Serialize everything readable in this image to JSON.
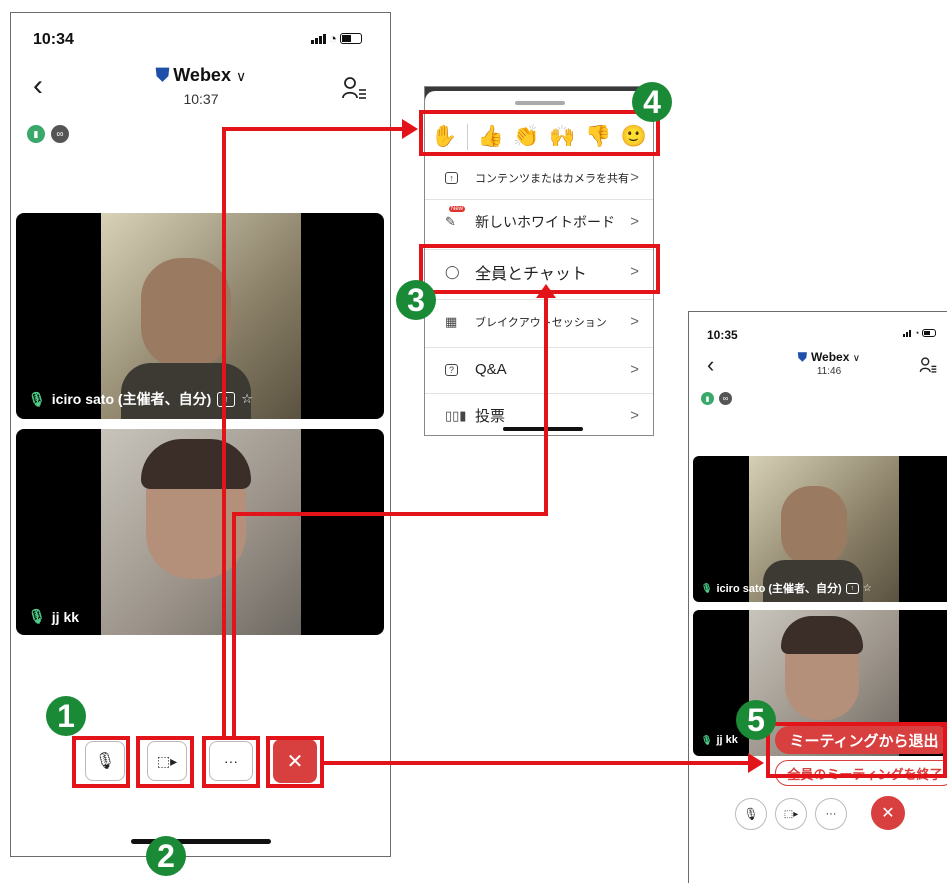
{
  "colors": {
    "accent_red": "#e2141a",
    "step_green": "#1a8a36",
    "end_red": "#d7403f",
    "mic_green": "#4fd08a"
  },
  "phone_main": {
    "status_time": "10:34",
    "title": "Webex",
    "title_chevron": "∨",
    "meeting_time": "10:37",
    "participants": [
      {
        "name": "iciro sato (主催者、自分)"
      },
      {
        "name": "jj kk"
      }
    ],
    "controls": {
      "more_label": "···",
      "end_label": "✕"
    }
  },
  "menu": {
    "emojis": [
      "✋",
      "👍",
      "👏",
      "🙌",
      "👎",
      "🙂"
    ],
    "items": [
      {
        "label": "コンテンツまたはカメラを共有",
        "icon": "share-up-icon"
      },
      {
        "label": "新しいホワイトボード",
        "icon": "whiteboard-pen-icon",
        "badge": "New"
      },
      {
        "label": "全員とチャット",
        "icon": "chat-bubble-icon"
      },
      {
        "label": "ブレイクアウトセッション",
        "icon": "breakout-grid-icon"
      },
      {
        "label": "Q&A",
        "icon": "qa-icon"
      },
      {
        "label": "投票",
        "icon": "poll-bars-icon"
      }
    ],
    "chevron": ">"
  },
  "phone_end": {
    "status_time": "10:35",
    "title": "Webex",
    "title_chevron": "∨",
    "meeting_time": "11:46",
    "participant_1": "iciro sato (主催者、自分)",
    "participant_2": "jj kk",
    "leave_label": "ミーティングから退出",
    "end_all_label": "全員のミーティングを終了",
    "more_label": "···",
    "end_label": "✕"
  },
  "steps": [
    "1",
    "2",
    "3",
    "4",
    "5"
  ]
}
